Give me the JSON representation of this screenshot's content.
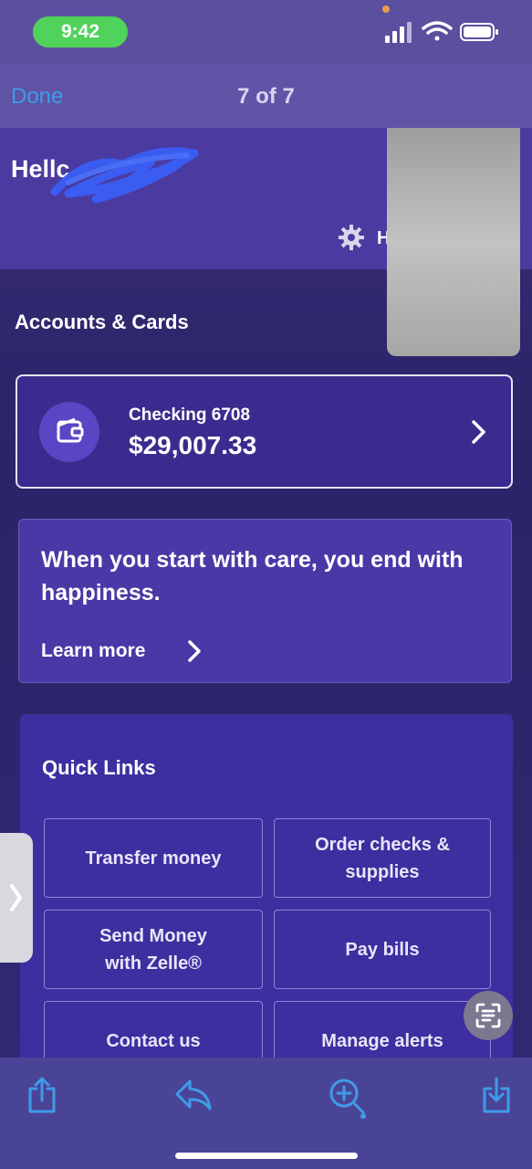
{
  "status_bar": {
    "time": "9:42",
    "icons": [
      "signal-icon",
      "wifi-icon",
      "battery-icon"
    ]
  },
  "viewer": {
    "done_label": "Done",
    "page_counter": "7 of 7",
    "toolbar_icons": [
      "share-icon",
      "markup-icon",
      "zoom-icon",
      "save-icon"
    ]
  },
  "header": {
    "greeting": "Hellc",
    "settings_letter": "H"
  },
  "accounts": {
    "section_title": "Accounts & Cards",
    "items": [
      {
        "name": "Checking 6708",
        "balance": "$29,007.33"
      }
    ]
  },
  "promo": {
    "text": "When you start with care, you end with happiness.",
    "link_label": "Learn more"
  },
  "quick_links": {
    "title": "Quick Links",
    "items": [
      {
        "label": "Transfer money"
      },
      {
        "label": "Order checks & supplies"
      },
      {
        "label": "Send Money with Zelle®"
      },
      {
        "label": "Pay bills"
      },
      {
        "label": "Contact us"
      },
      {
        "label": "Manage alerts"
      }
    ]
  },
  "colors": {
    "accent_blue": "#3f9be8",
    "time_pill_green": "#4fd35a",
    "brand_purple": "#4b3aa0"
  }
}
